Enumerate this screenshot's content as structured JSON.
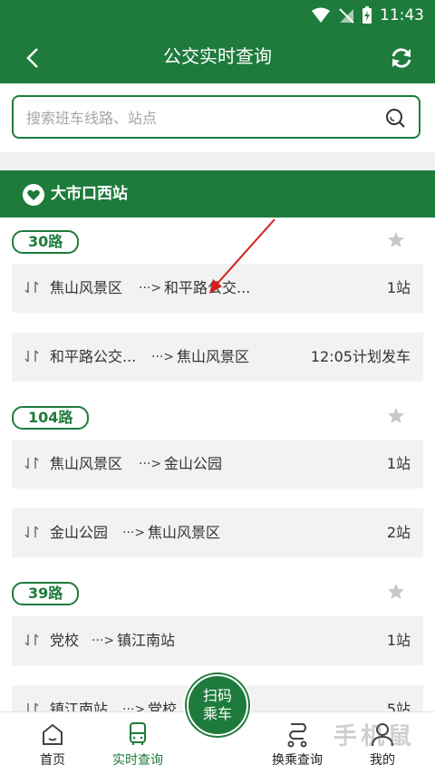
{
  "status_bar": {
    "time": "11:43"
  },
  "app_bar": {
    "title": "公交实时查询"
  },
  "search": {
    "placeholder": "搜索班车线路、站点"
  },
  "station": {
    "name": "大市口西站"
  },
  "routes": [
    {
      "tag": "30路",
      "rows": [
        {
          "from": "焦山风景区",
          "to": "和平路公交...",
          "info": "1站"
        },
        {
          "from": "和平路公交...",
          "to": "焦山风景区",
          "info": "12:05计划发车"
        }
      ]
    },
    {
      "tag": "104路",
      "rows": [
        {
          "from": "焦山风景区",
          "to": "金山公园",
          "info": "1站"
        },
        {
          "from": "金山公园",
          "to": "焦山风景区",
          "info": "2站"
        }
      ]
    },
    {
      "tag": "39路",
      "rows": [
        {
          "from": "党校",
          "to": "镇江南站",
          "info": "1站"
        },
        {
          "from": "镇江南站",
          "to": "党校",
          "info": "5站"
        }
      ]
    }
  ],
  "arrow_symbol": "···>",
  "tabs": [
    {
      "label": "首页",
      "icon": "home-icon"
    },
    {
      "label": "实时查询",
      "icon": "bus-icon"
    },
    {
      "label": "换乘查询",
      "icon": "transfer-route-icon"
    },
    {
      "label": "我的",
      "icon": "user-icon"
    }
  ],
  "scan_button": {
    "line1": "扫码",
    "line2": "乘车"
  },
  "watermark": "手机鼠",
  "colors": {
    "primary": "#1e7b3c",
    "annotation_arrow": "#d42020"
  }
}
